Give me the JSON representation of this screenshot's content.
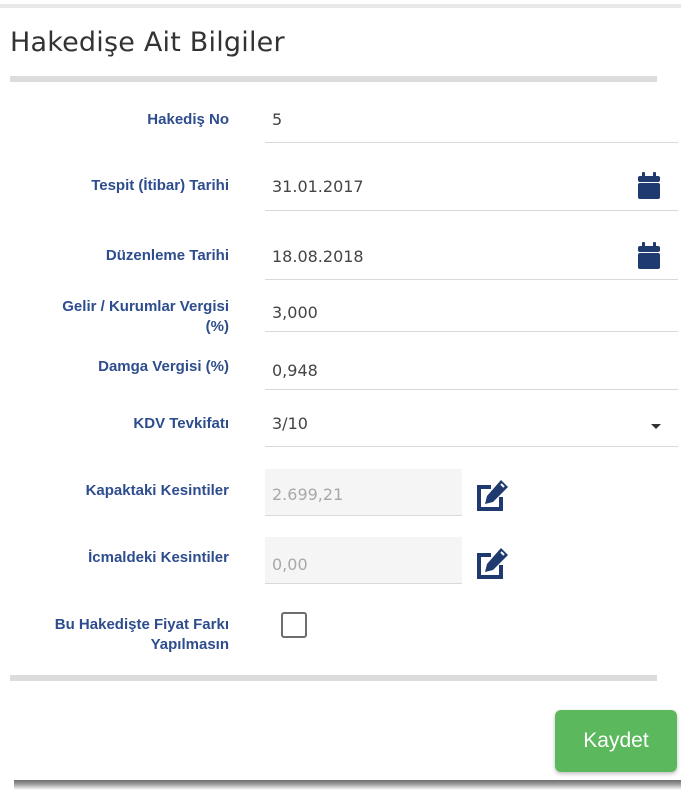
{
  "panel": {
    "title": "Hakedişe Ait Bilgiler"
  },
  "fields": {
    "hakedis_no": {
      "label": "Hakediş No",
      "value": "5"
    },
    "tespit_tarihi": {
      "label": "Tespit (İtibar) Tarihi",
      "value": "31.01.2017",
      "icon": "calendar-icon"
    },
    "duzenleme_tarihi": {
      "label": "Düzenleme Tarihi",
      "value": "18.08.2018",
      "icon": "calendar-icon"
    },
    "gelir_vergisi": {
      "label_line1": "Gelir / Kurumlar Vergisi",
      "label_line2": "(%)",
      "value": "3,000"
    },
    "damga_vergisi": {
      "label": "Damga Vergisi (%)",
      "value": "0,948"
    },
    "kdv_tevkifati": {
      "label": "KDV Tevkifatı",
      "selected": "3/10",
      "icon": "caret-down-icon"
    },
    "kapak_kesintiler": {
      "label": "Kapaktaki Kesintiler",
      "value": "2.699,21",
      "icon": "edit-icon"
    },
    "icmal_kesintiler": {
      "label": "İcmaldeki Kesintiler",
      "value": "0,00",
      "icon": "edit-icon"
    },
    "fiyat_farki": {
      "label_line1": "Bu Hakedişte Fiyat Farkı",
      "label_line2": "Yapılmasın",
      "checked": false
    }
  },
  "actions": {
    "save_label": "Kaydet"
  },
  "colors": {
    "label": "#2e4d8e",
    "icon": "#1f3a6e",
    "save_button": "#5cb85c",
    "value_text": "#444444",
    "readonly_text": "#a8a8a8"
  }
}
